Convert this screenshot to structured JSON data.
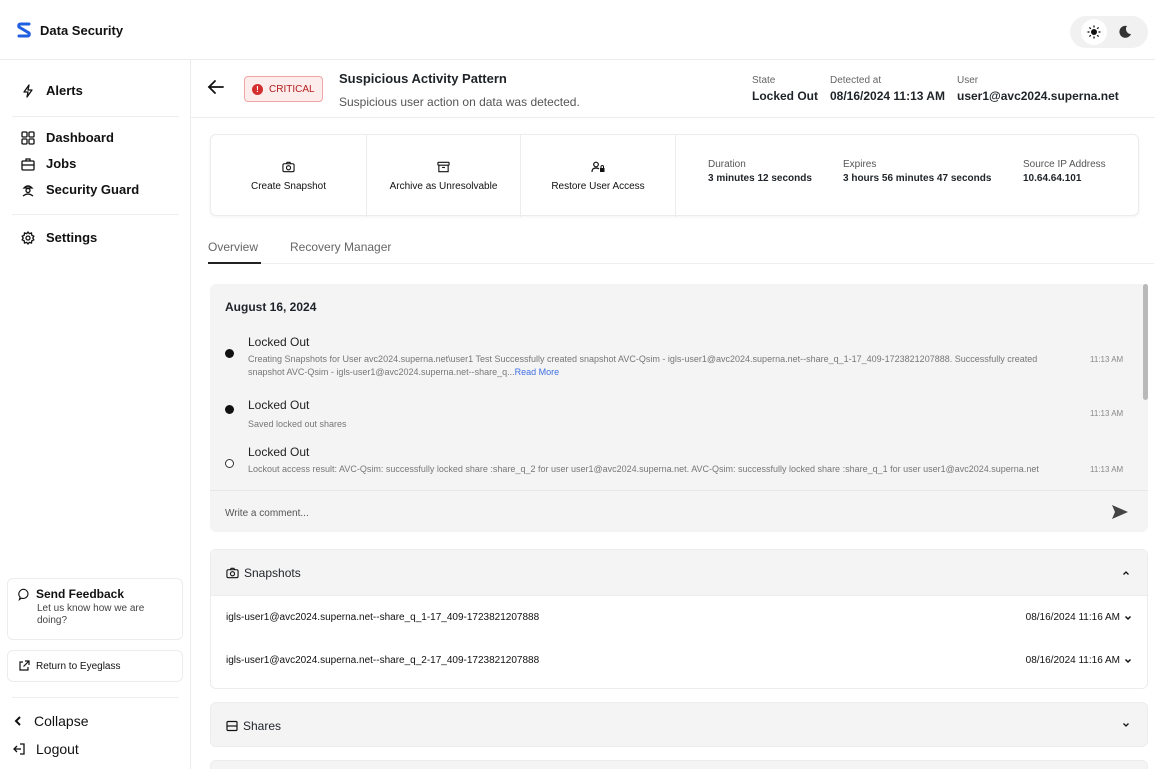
{
  "app": {
    "title": "Data Security"
  },
  "sidebar": {
    "items": [
      {
        "label": "Alerts",
        "icon": "alerts-icon"
      },
      {
        "label": "Dashboard",
        "icon": "dashboard-icon"
      },
      {
        "label": "Jobs",
        "icon": "jobs-icon"
      },
      {
        "label": "Security Guard",
        "icon": "security-guard-icon"
      },
      {
        "label": "Settings",
        "icon": "settings-icon"
      }
    ],
    "feedback": {
      "title": "Send Feedback",
      "subtitle": "Let us know how we are doing?"
    },
    "return_label": "Return to Eyeglass",
    "collapse_label": "Collapse",
    "logout_label": "Logout"
  },
  "alert": {
    "severity": "CRITICAL",
    "severity_color": "#d32f2f",
    "title": "Suspicious Activity Pattern",
    "subtitle": "Suspicious user action on data was detected.",
    "state_label": "State",
    "state_value": "Locked Out",
    "detected_label": "Detected at",
    "detected_value": "08/16/2024 11:13 AM",
    "user_label": "User",
    "user_value": "user1@avc2024.superna.net"
  },
  "actions": [
    {
      "label": "Create Snapshot",
      "icon": "camera-icon"
    },
    {
      "label": "Archive as Unresolvable",
      "icon": "archive-icon"
    },
    {
      "label": "Restore User Access",
      "icon": "user-lock-icon"
    }
  ],
  "info": {
    "duration_label": "Duration",
    "duration_value": "3 minutes 12 seconds",
    "expires_label": "Expires",
    "expires_value": "3 hours 56 minutes 47 seconds",
    "ip_label": "Source IP Address",
    "ip_value": "10.64.64.101"
  },
  "tabs": [
    {
      "label": "Overview",
      "active": true
    },
    {
      "label": "Recovery Manager",
      "active": false
    }
  ],
  "timeline": {
    "date": "August 16, 2024",
    "events": [
      {
        "title": "Locked Out",
        "detail": "Creating Snapshots for User avc2024.superna.net\\user1 Test Successfully created snapshot AVC-Qsim - igls-user1@avc2024.superna.net--share_q_1-17_409-1723821207888. Successfully created snapshot AVC-Qsim - igls-user1@avc2024.superna.net--share_q...",
        "read_more": "Read More",
        "time": "11:13 AM"
      },
      {
        "title": "Locked Out",
        "detail": "Saved locked out shares",
        "time": "11:13 AM"
      },
      {
        "title": "Locked Out",
        "detail": "Lockout access result: AVC-Qsim: successfully locked share :share_q_2 for user user1@avc2024.superna.net. AVC-Qsim: successfully locked share :share_q_1 for user user1@avc2024.superna.net",
        "time": "11:13 AM"
      }
    ]
  },
  "comment": {
    "placeholder": "Write a comment..."
  },
  "snapshots": {
    "title": "Snapshots",
    "rows": [
      {
        "name": "igls-user1@avc2024.superna.net--share_q_1-17_409-1723821207888",
        "date": "08/16/2024 11:16 AM"
      },
      {
        "name": "igls-user1@avc2024.superna.net--share_q_2-17_409-1723821207888",
        "date": "08/16/2024 11:16 AM"
      }
    ]
  },
  "shares": {
    "title": "Shares"
  }
}
